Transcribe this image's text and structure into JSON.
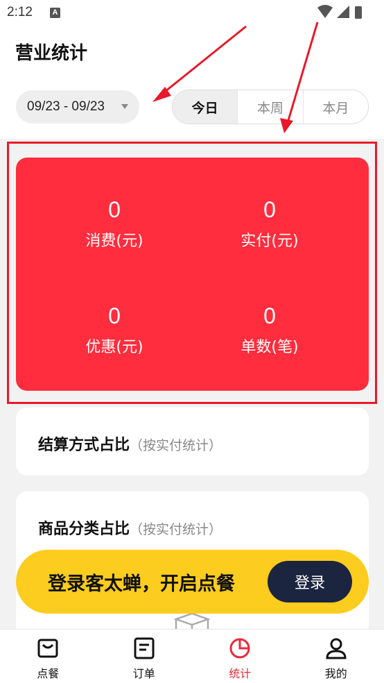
{
  "status_bar": {
    "time": "2:12",
    "notification_letter": "A"
  },
  "header": {
    "title": "营业统计",
    "date_range": "09/23 - 09/23",
    "period_tabs": [
      {
        "label": "今日",
        "selected": true
      },
      {
        "label": "本周",
        "selected": false
      },
      {
        "label": "本月",
        "selected": false
      }
    ]
  },
  "stats": {
    "consumption": {
      "value": "0",
      "label": "消费(元)"
    },
    "paid": {
      "value": "0",
      "label": "实付(元)"
    },
    "discount": {
      "value": "0",
      "label": "优惠(元)"
    },
    "orders": {
      "value": "0",
      "label": "单数(笔)"
    }
  },
  "panels": {
    "payment_method": {
      "title": "结算方式占比",
      "subtitle": "（按实付统计）"
    },
    "category": {
      "title": "商品分类占比",
      "subtitle": "（按实付统计）"
    }
  },
  "login_banner": {
    "text": "登录客太蝉，开启点餐",
    "button": "登录"
  },
  "tabbar": {
    "items": [
      {
        "label": "点餐",
        "icon": "bag-icon",
        "active": false
      },
      {
        "label": "订单",
        "icon": "orders-icon",
        "active": false
      },
      {
        "label": "统计",
        "icon": "pie-chart-icon",
        "active": true
      },
      {
        "label": "我的",
        "icon": "user-icon",
        "active": false
      }
    ]
  },
  "colors": {
    "accent_red": "#ff2d3d",
    "highlight_red": "#e8192a",
    "banner_yellow": "#fccc1e",
    "login_button": "#1c2540"
  }
}
